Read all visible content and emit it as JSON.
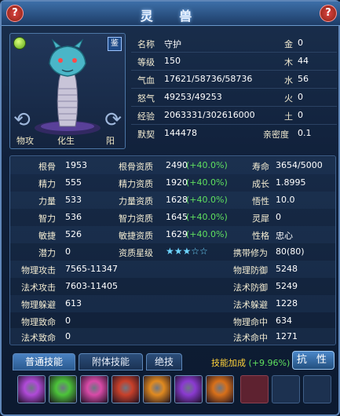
{
  "window": {
    "title": "灵 兽",
    "help": "?",
    "close": "?"
  },
  "pet_panel": {
    "identify_label": "鉴",
    "arrow_left": "⟲",
    "arrow_right": "⟳",
    "buttons": [
      "物攻",
      "化生",
      "阳"
    ]
  },
  "info": [
    {
      "label": "名称",
      "value": "守护",
      "label2": "金",
      "value2": "0"
    },
    {
      "label": "等级",
      "value": "150",
      "label2": "木",
      "value2": "44"
    },
    {
      "label": "气血",
      "value": "17621/58736/58736",
      "label2": "水",
      "value2": "56"
    },
    {
      "label": "怒气",
      "value": "49253/49253",
      "label2": "火",
      "value2": "0"
    },
    {
      "label": "经验",
      "value": "2063331/302616000",
      "label2": "土",
      "value2": "0"
    },
    {
      "label": "默契",
      "value": "144478",
      "label2": "亲密度",
      "value2": "0.1"
    }
  ],
  "stats": [
    {
      "a": "根骨",
      "av": "1953",
      "b": "根骨资质",
      "bv": "2490",
      "bg": "(+40.0%)",
      "c": "寿命",
      "cv": "3654/5000"
    },
    {
      "a": "精力",
      "av": "555",
      "b": "精力资质",
      "bv": "1920",
      "bg": "(+40.0%)",
      "c": "成长",
      "cv": "1.8995"
    },
    {
      "a": "力量",
      "av": "533",
      "b": "力量资质",
      "bv": "1628",
      "bg": "(+40.0%)",
      "c": "悟性",
      "cv": "10.0"
    },
    {
      "a": "智力",
      "av": "536",
      "b": "智力资质",
      "bv": "1645",
      "bg": "(+40.0%)",
      "c": "灵犀",
      "cv": "0"
    },
    {
      "a": "敏捷",
      "av": "526",
      "b": "敏捷资质",
      "bv": "1629",
      "bg": "(+40.0%)",
      "c": "性格",
      "cv": "忠心"
    },
    {
      "a": "潜力",
      "av": "0",
      "b": "资质星级",
      "bv": "★★★☆☆",
      "bg": "",
      "c": "携带修为",
      "cv": "80(80)"
    }
  ],
  "combat": [
    {
      "a": "物理攻击",
      "av": "7565-11347",
      "c": "物理防御",
      "cv": "5248"
    },
    {
      "a": "法术攻击",
      "av": "7603-11405",
      "c": "法术防御",
      "cv": "5249"
    },
    {
      "a": "物理躲避",
      "av": "613",
      "c": "法术躲避",
      "cv": "1228"
    },
    {
      "a": "物理致命",
      "av": "0",
      "c": "物理命中",
      "cv": "634"
    },
    {
      "a": "法术致命",
      "av": "0",
      "c": "法术命中",
      "cv": "1271"
    }
  ],
  "tabs": [
    "普通技能",
    "附体技能",
    "绝技"
  ],
  "skill_bonus": {
    "label": "技能加成",
    "value": "(+9.96%)"
  },
  "resist_button": "抗 性",
  "skill_colors": [
    "#b04ad8",
    "#4cc43a",
    "#d84aa8",
    "#c8402a",
    "#e08a20",
    "#8a3ad0",
    "#d8701a"
  ]
}
